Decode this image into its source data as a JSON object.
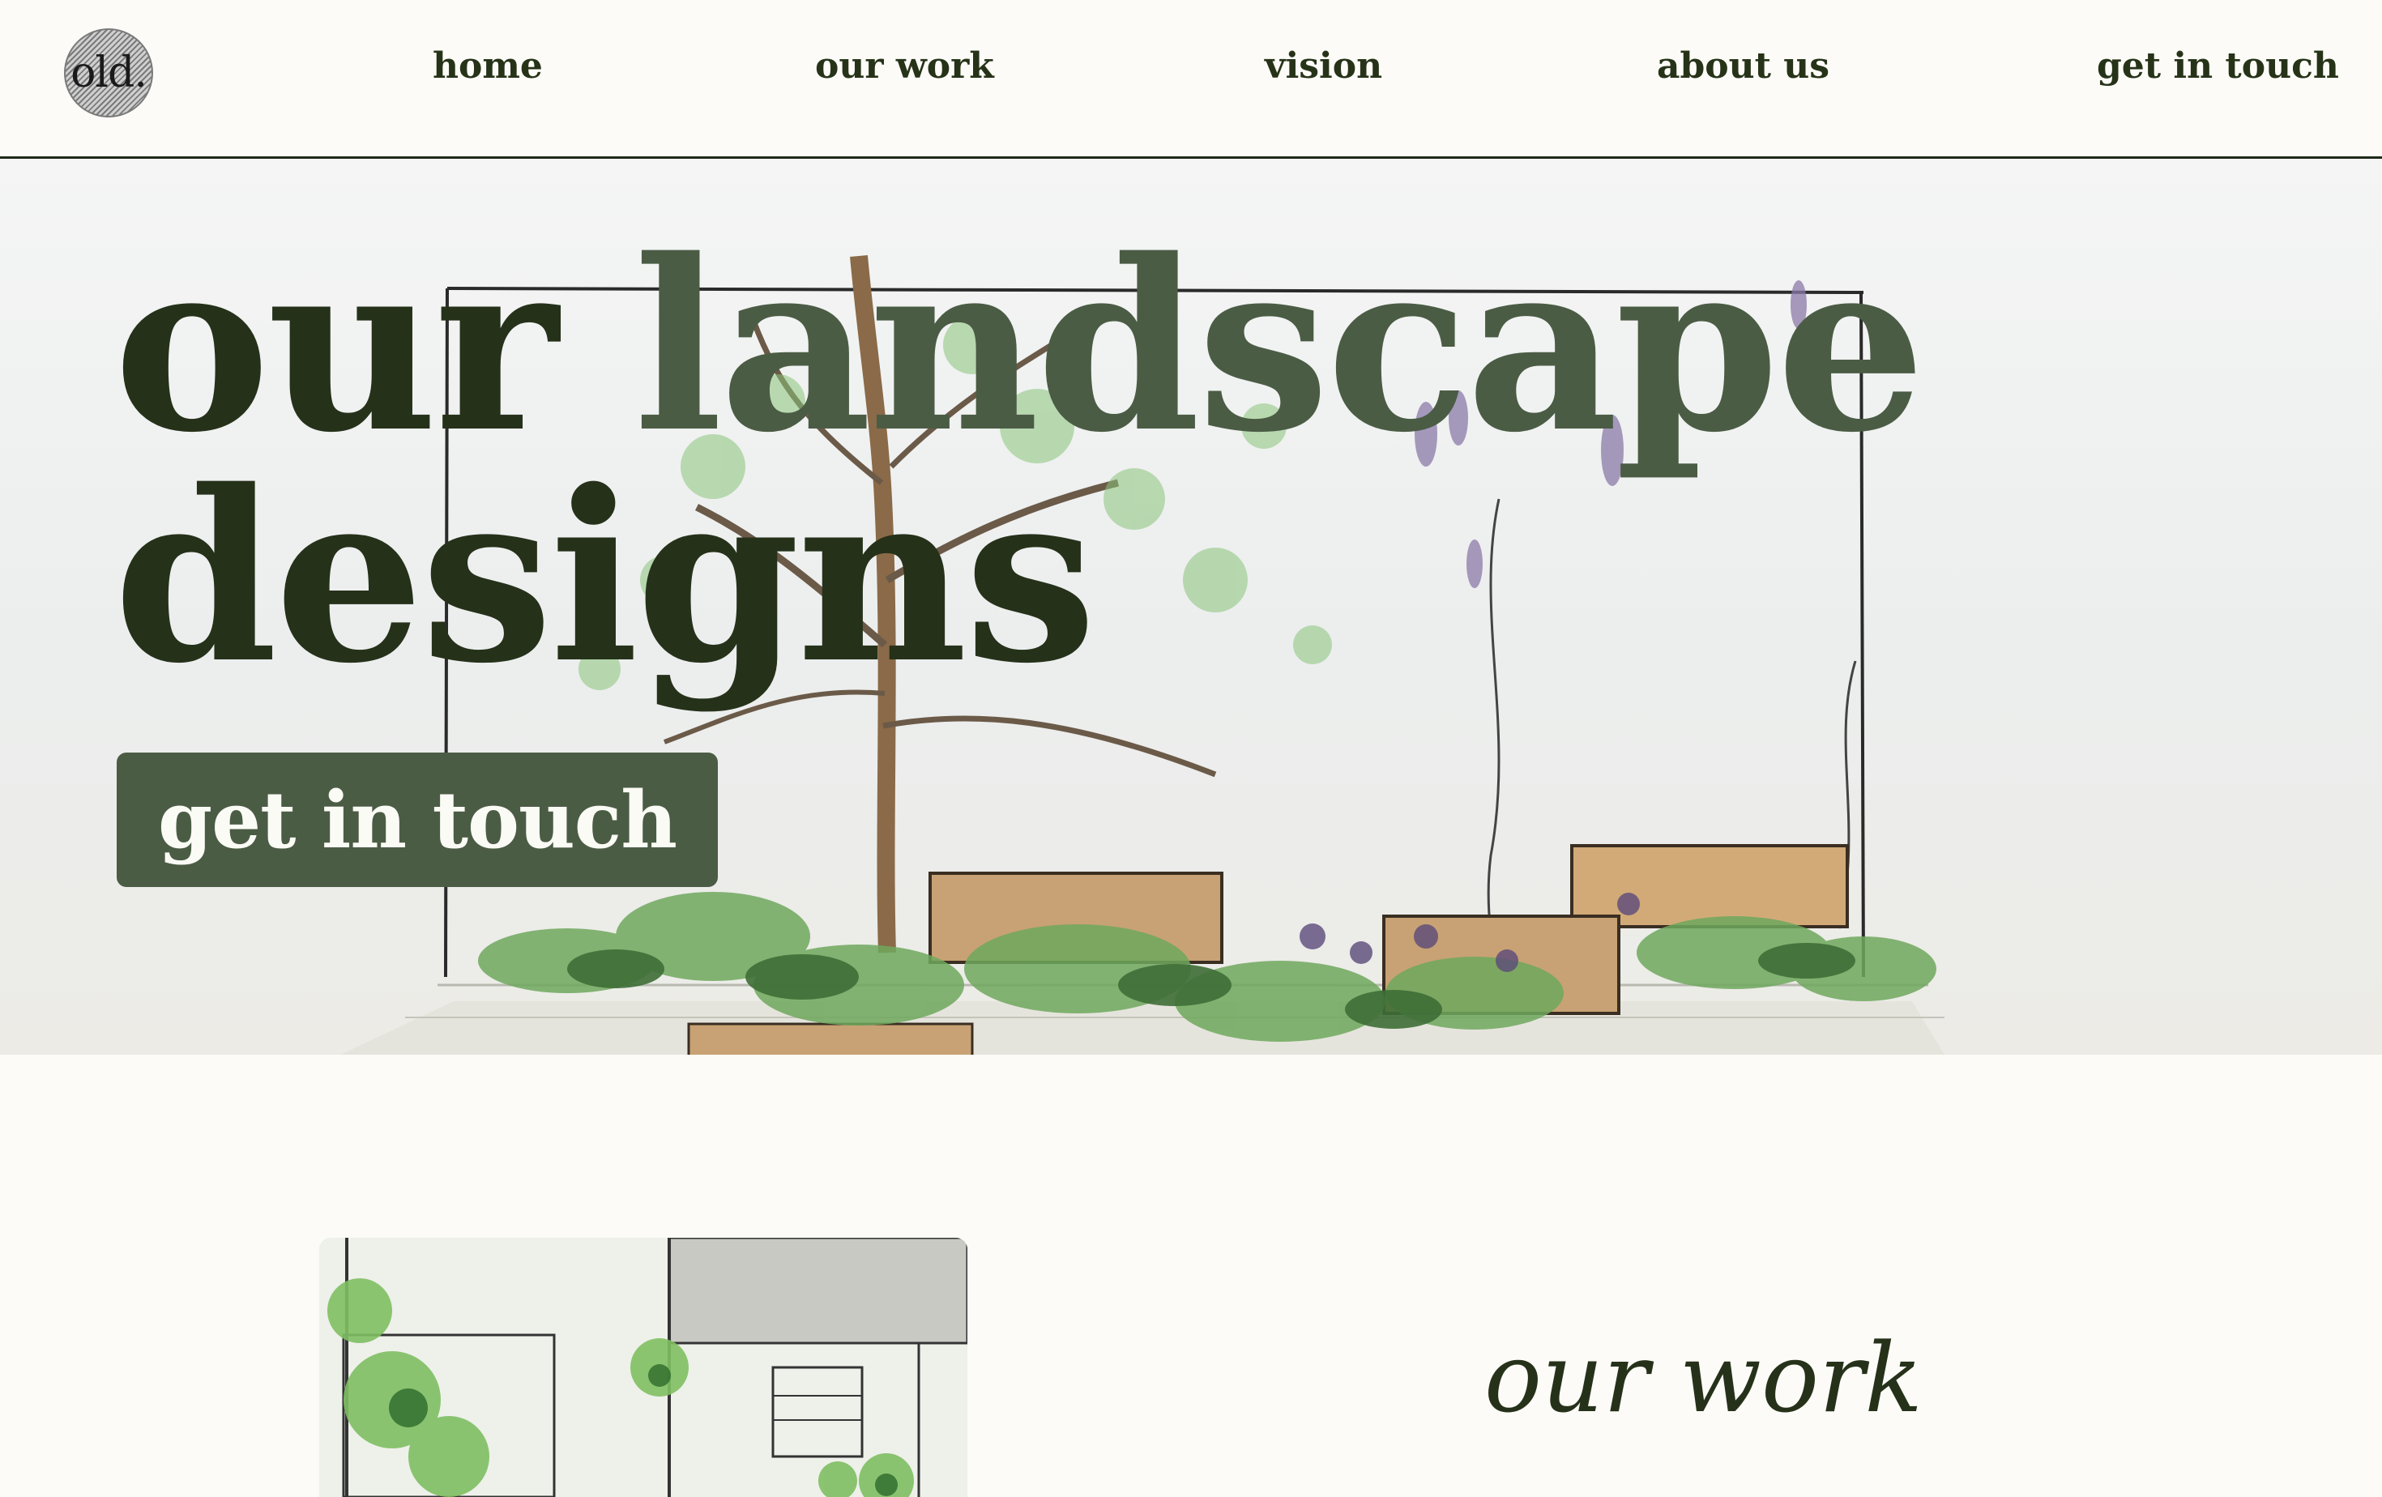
{
  "nav": {
    "logo_text": "old.",
    "items": [
      "home",
      "our work",
      "vision",
      "about us",
      "get in touch"
    ]
  },
  "hero": {
    "title_word1": "our",
    "title_word2": "landscape",
    "title_word3": "designs",
    "cta_label": "get in touch"
  },
  "work": {
    "title": "our work"
  },
  "colors": {
    "background": "#fcfbf7",
    "text_dark": "#26311a",
    "accent_green": "#4b5c45",
    "button_text": "#fbfbf6"
  }
}
